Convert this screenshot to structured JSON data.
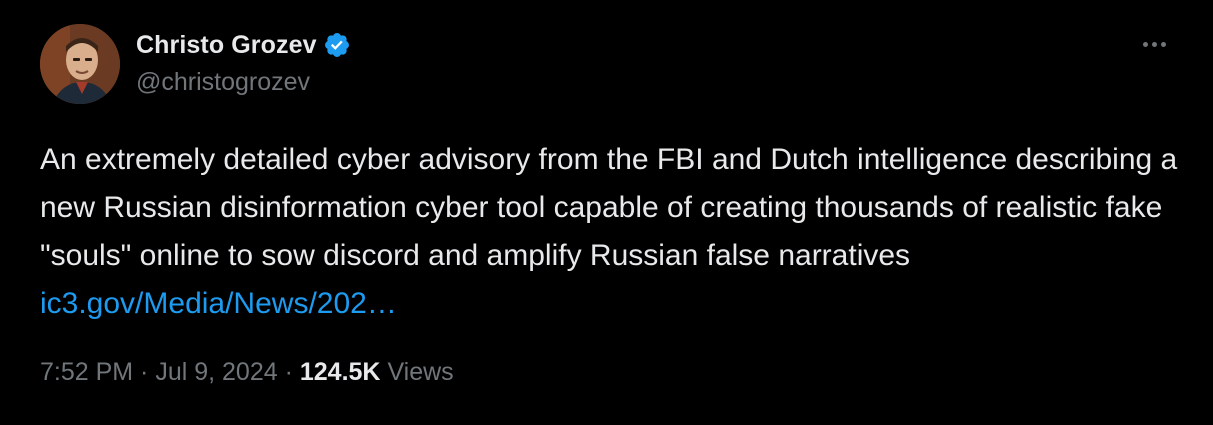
{
  "author": {
    "display_name": "Christo Grozev",
    "handle": "@christogrozev",
    "verified": true
  },
  "tweet": {
    "text": "An extremely detailed cyber advisory from the FBI and Dutch intelligence describing a new Russian disinformation cyber tool capable of creating thousands of realistic fake \"souls\" online to sow discord and amplify Russian false narratives ",
    "link_text": "ic3.gov/Media/News/202…"
  },
  "meta": {
    "time": "7:52 PM",
    "separator": " · ",
    "date": "Jul 9, 2024",
    "views_count": "124.5K",
    "views_label": " Views"
  },
  "colors": {
    "background": "#000000",
    "primary_text": "#e7e9ea",
    "secondary_text": "#71767b",
    "link": "#1d9bf0",
    "verified_badge": "#1d9bf0"
  },
  "icons": {
    "verified": "verified-badge-icon",
    "more": "more-options-icon"
  }
}
